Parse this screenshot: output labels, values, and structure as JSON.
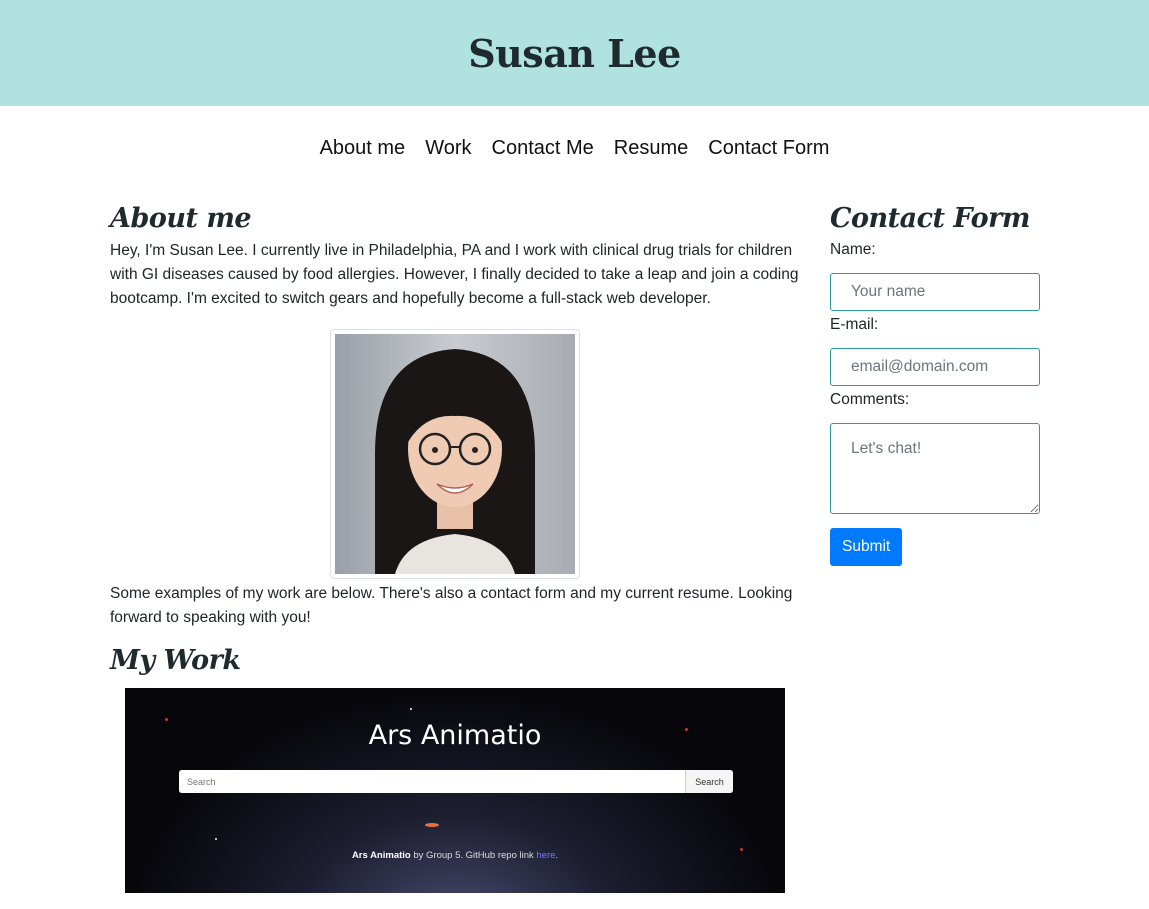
{
  "header": {
    "title": "Susan Lee"
  },
  "nav": {
    "items": [
      {
        "label": "About me"
      },
      {
        "label": "Work"
      },
      {
        "label": "Contact Me"
      },
      {
        "label": "Resume"
      },
      {
        "label": "Contact Form"
      }
    ]
  },
  "about": {
    "heading": "About me",
    "paragraph1": "Hey, I'm Susan Lee. I currently live in Philadelphia, PA and I work with clinical drug trials for children with GI diseases caused by food allergies. However, I finally decided to take a leap and join a coding bootcamp. I'm excited to switch gears and hopefully become a full-stack web developer.",
    "paragraph2": "Some examples of my work are below. There's also a contact form and my current resume. Looking forward to speaking with you!"
  },
  "work": {
    "heading": "My Work",
    "project": {
      "title": "Ars Animatio",
      "search_placeholder": "Search",
      "search_button": "Search",
      "caption_name": "Ars Animatio",
      "caption_text": " by Group 5. GitHub repo link ",
      "caption_link": "here",
      "caption_end": "."
    }
  },
  "contact_form": {
    "heading": "Contact Form",
    "name_label": "Name:",
    "name_placeholder": "Your name",
    "email_label": "E-mail:",
    "email_placeholder": "email@domain.com",
    "comments_label": "Comments:",
    "comments_placeholder": "Let's chat!",
    "submit_label": "Submit"
  },
  "colors": {
    "header_bg": "#b0e3e0",
    "submit_bg": "#007bff",
    "field_border": "#2a9d9a"
  }
}
